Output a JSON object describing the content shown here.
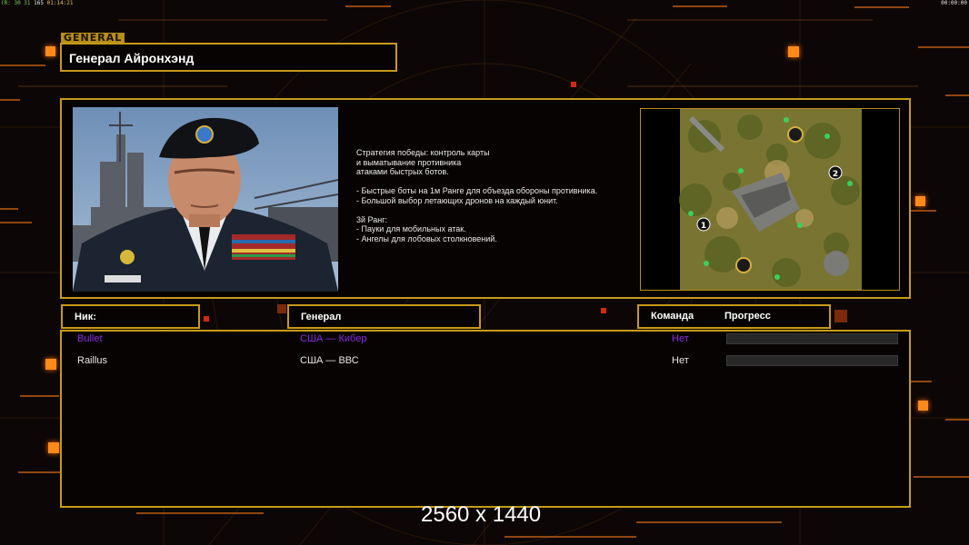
{
  "hud": {
    "left_fps_a": "(R:",
    "left_fps_b": "30 31",
    "left_fps_c": "165",
    "left_time": "01:14:21",
    "right_time": "00:00:00"
  },
  "general_tag": "GENERAL",
  "general_name": "Генерал Айронхэнд",
  "strategy_text": "Стратегия победы: контроль карты\nи выматывание противника\nатаками быстрых ботов.\n\n- Быстрые боты на 1м Ранге для объезда обороны противника.\n- Большой выбор летающих дронов на каждый юнит.\n\n3й Ранг:\n- Пауки для мобильных атак.\n- Ангелы для лобовых столкновений.",
  "map_markers": [
    "1",
    "2"
  ],
  "headers": {
    "nick": "Ник:",
    "general": "Генерал",
    "team": "Команда",
    "progress": "Прогресс"
  },
  "players": [
    {
      "nick": "Bullet",
      "general": "США — Кибер",
      "team": "Нет",
      "color": "#8a2be2",
      "progress": 0
    },
    {
      "nick": "Raillus",
      "general": "США — ВВС",
      "team": "Нет",
      "color": "#e6e6e6",
      "progress": 0
    }
  ],
  "watermark": "2560 x 1440",
  "colors": {
    "accent": "#c79a17",
    "glow": "#ff8a1a"
  }
}
